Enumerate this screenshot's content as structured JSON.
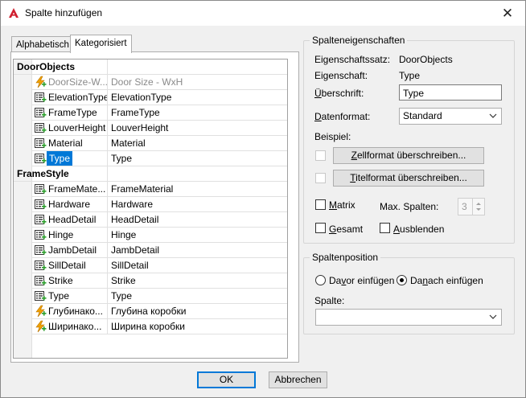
{
  "window": {
    "title": "Spalte hinzufügen",
    "close_glyph": "✕"
  },
  "tabs": [
    {
      "label": "Alphabetisch",
      "active": false
    },
    {
      "label": "Kategorisiert",
      "active": true
    }
  ],
  "tree": {
    "groups": [
      {
        "name": "DoorObjects",
        "rows": [
          {
            "prop": "DoorSize-W...",
            "value": "Door Size - WxH",
            "icon": "formula-icon",
            "gray": true
          },
          {
            "prop": "ElevationType",
            "value": "ElevationType",
            "icon": "property-icon"
          },
          {
            "prop": "FrameType",
            "value": "FrameType",
            "icon": "property-icon"
          },
          {
            "prop": "LouverHeight",
            "value": "LouverHeight",
            "icon": "property-icon"
          },
          {
            "prop": "Material",
            "value": "Material",
            "icon": "property-icon"
          },
          {
            "prop": "Type",
            "value": "Type",
            "icon": "property-icon",
            "selected": true
          }
        ]
      },
      {
        "name": "FrameStyle",
        "rows": [
          {
            "prop": "FrameMate...",
            "value": "FrameMaterial",
            "icon": "property-icon"
          },
          {
            "prop": "Hardware",
            "value": "Hardware",
            "icon": "property-icon"
          },
          {
            "prop": "HeadDetail",
            "value": "HeadDetail",
            "icon": "property-icon"
          },
          {
            "prop": "Hinge",
            "value": "Hinge",
            "icon": "property-icon"
          },
          {
            "prop": "JambDetail",
            "value": "JambDetail",
            "icon": "property-icon"
          },
          {
            "prop": "SillDetail",
            "value": "SillDetail",
            "icon": "property-icon"
          },
          {
            "prop": "Strike",
            "value": "Strike",
            "icon": "property-icon"
          },
          {
            "prop": "Type",
            "value": "Type",
            "icon": "property-icon"
          },
          {
            "prop": "Глубинако...",
            "value": "Глубина коробки",
            "icon": "formula-icon"
          },
          {
            "prop": "Ширинако...",
            "value": "Ширина коробки",
            "icon": "formula-icon"
          }
        ]
      }
    ]
  },
  "props_group": {
    "title": "Spalteneigenschaften",
    "set_label": "Eigenschaftssatz:",
    "set_value": "DoorObjects",
    "prop_label": "Eigenschaft:",
    "prop_value": "Type",
    "heading_label_pre": "",
    "heading_label_u": "Ü",
    "heading_label_post": "berschrift:",
    "heading_value": "Type",
    "format_label_u": "D",
    "format_label_post": "atenformat:",
    "format_value": "Standard",
    "example_label": "Beispiel:",
    "cell_btn_u": "Z",
    "cell_btn_post": "ellformat überschreiben...",
    "title_btn_u": "T",
    "title_btn_post": "itelformat überschreiben...",
    "matrix_u": "M",
    "matrix_post": "atrix",
    "max_cols_label": "Max. Spalten:",
    "max_cols_value": "3",
    "total_u": "G",
    "total_post": "esamt",
    "hide_u": "A",
    "hide_post": "usblenden"
  },
  "position_group": {
    "title": "Spaltenposition",
    "before_pre": "Da",
    "before_u": "v",
    "before_post": "or einfügen",
    "after_pre": "Da",
    "after_u": "n",
    "after_post": "ach einfügen",
    "column_label": "Spalte:",
    "column_value": ""
  },
  "buttons": {
    "ok": "OK",
    "cancel": "Abbrechen"
  },
  "colors": {
    "accent": "#0078d7",
    "app_icon": "#d01f2f",
    "formula_icon": "#f0a000"
  }
}
